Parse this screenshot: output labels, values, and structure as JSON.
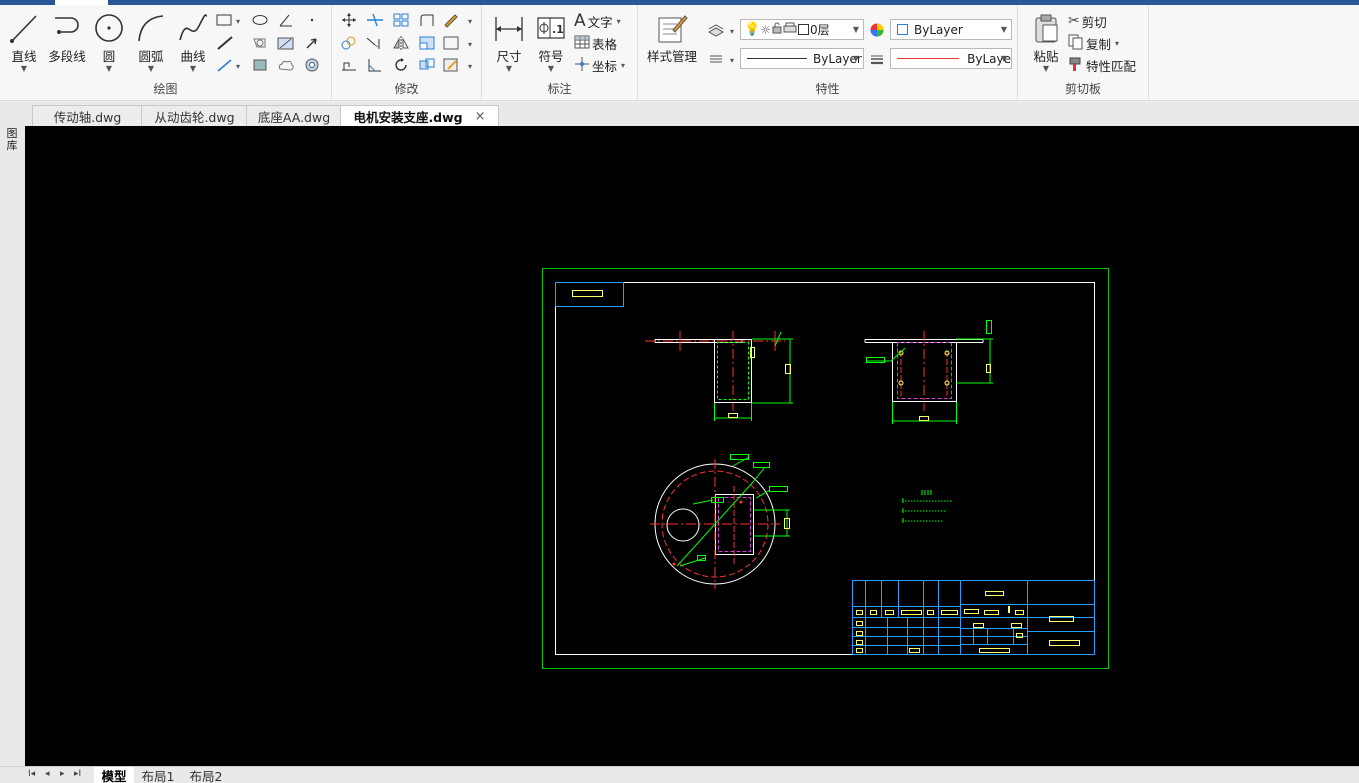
{
  "ribbon": {
    "draw": {
      "label": "绘图",
      "line": "直线",
      "polyline": "多段线",
      "circle": "圆",
      "arc": "圆弧",
      "spline": "曲线"
    },
    "modify": {
      "label": "修改"
    },
    "annotate": {
      "label": "标注",
      "dimension": "尺寸",
      "symbol": "符号",
      "text": "文字",
      "table": "表格",
      "coord": "坐标"
    },
    "properties": {
      "label": "特性",
      "style_manager": "样式管理",
      "layer": "0层",
      "color": "ByLayer",
      "linetype": "ByLayer",
      "lineweight": "ByLaye"
    },
    "clipboard": {
      "label": "剪切板",
      "paste": "粘贴",
      "cut": "剪切",
      "copy": "复制",
      "match": "特性匹配"
    }
  },
  "tabs": [
    {
      "label": "传动轴.dwg",
      "active": false
    },
    {
      "label": "从动齿轮.dwg",
      "active": false
    },
    {
      "label": "底座AA.dwg",
      "active": false
    },
    {
      "label": "电机安装支座.dwg",
      "active": true
    }
  ],
  "tab_close": "×",
  "sidebar": {
    "label": "图库"
  },
  "layout_tabs": [
    {
      "label": "模型",
      "active": true
    },
    {
      "label": "布局1",
      "active": false
    },
    {
      "label": "布局2",
      "active": false
    }
  ],
  "colors": {
    "accent": "#2b5797",
    "canvas": "#000000",
    "border_green": "#00c800",
    "frame_white": "#ffffff",
    "dim_green": "#00ff00",
    "center_red": "#ff3030",
    "title_cyan": "#2aa0ff",
    "label_yellow": "#ffff66",
    "hidden_magenta": "#d040d0"
  }
}
